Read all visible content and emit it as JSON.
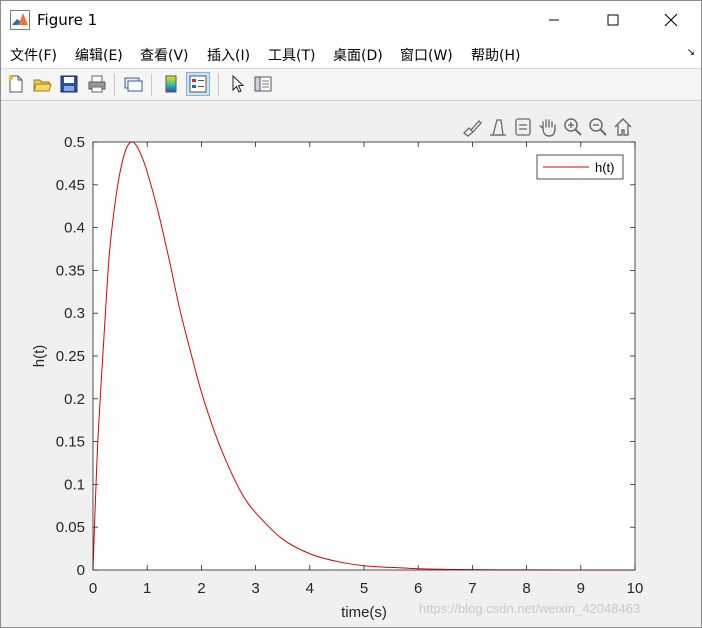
{
  "window": {
    "title": "Figure 1"
  },
  "menu": {
    "items": [
      "文件(F)",
      "编辑(E)",
      "查看(V)",
      "插入(I)",
      "工具(T)",
      "桌面(D)",
      "窗口(W)",
      "帮助(H)"
    ]
  },
  "toolbar": {
    "icons": [
      "new-figure-icon",
      "open-file-icon",
      "save-icon",
      "print-icon",
      "link-plot-icon",
      "insert-colorbar-icon",
      "insert-legend-icon",
      "edit-plot-arrow-icon",
      "property-inspector-icon"
    ]
  },
  "axes_toolbar": {
    "icons": [
      "brush-icon",
      "data-tips-icon",
      "restore-view-icon",
      "pan-hand-icon",
      "zoom-in-icon",
      "zoom-out-icon",
      "home-icon"
    ]
  },
  "watermark": "https://blog.csdn.net/weixin_42048463",
  "colors": {
    "line": "#e00000",
    "axes_bg": "#ffffff",
    "figure_bg": "#f0f0f0"
  },
  "chart_data": {
    "type": "line",
    "title": "",
    "xlabel": "time(s)",
    "ylabel": "h(t)",
    "xlim": [
      0,
      10
    ],
    "ylim": [
      0,
      0.5
    ],
    "xticks": [
      "0",
      "1",
      "2",
      "3",
      "4",
      "5",
      "6",
      "7",
      "8",
      "9",
      "10"
    ],
    "yticks": [
      "0",
      "0.05",
      "0.1",
      "0.15",
      "0.2",
      "0.25",
      "0.3",
      "0.35",
      "0.4",
      "0.45",
      "0.5"
    ],
    "legend": {
      "placement": "top-right",
      "entries": [
        "h(t)"
      ]
    },
    "grid": false,
    "series": [
      {
        "name": "h(t)",
        "color": "#e00000",
        "x": [
          0,
          0.05,
          0.1,
          0.2,
          0.3,
          0.4,
          0.5,
          0.6,
          0.7,
          0.8,
          0.9,
          1.0,
          1.2,
          1.4,
          1.6,
          1.8,
          2.0,
          2.25,
          2.5,
          2.75,
          3.0,
          3.5,
          4.0,
          4.5,
          5.0,
          5.5,
          6.0,
          6.5,
          7.0,
          7.5,
          8.0,
          9.0,
          10.0
        ],
        "y": [
          0,
          0.09,
          0.164,
          0.27,
          0.368,
          0.425,
          0.465,
          0.49,
          0.5,
          0.496,
          0.483,
          0.465,
          0.419,
          0.364,
          0.305,
          0.255,
          0.208,
          0.16,
          0.121,
          0.089,
          0.067,
          0.036,
          0.019,
          0.01,
          0.005,
          0.003,
          0.0015,
          0.0008,
          0.0004,
          0.0002,
          0.0001,
          3e-05,
          1e-05
        ]
      }
    ]
  }
}
